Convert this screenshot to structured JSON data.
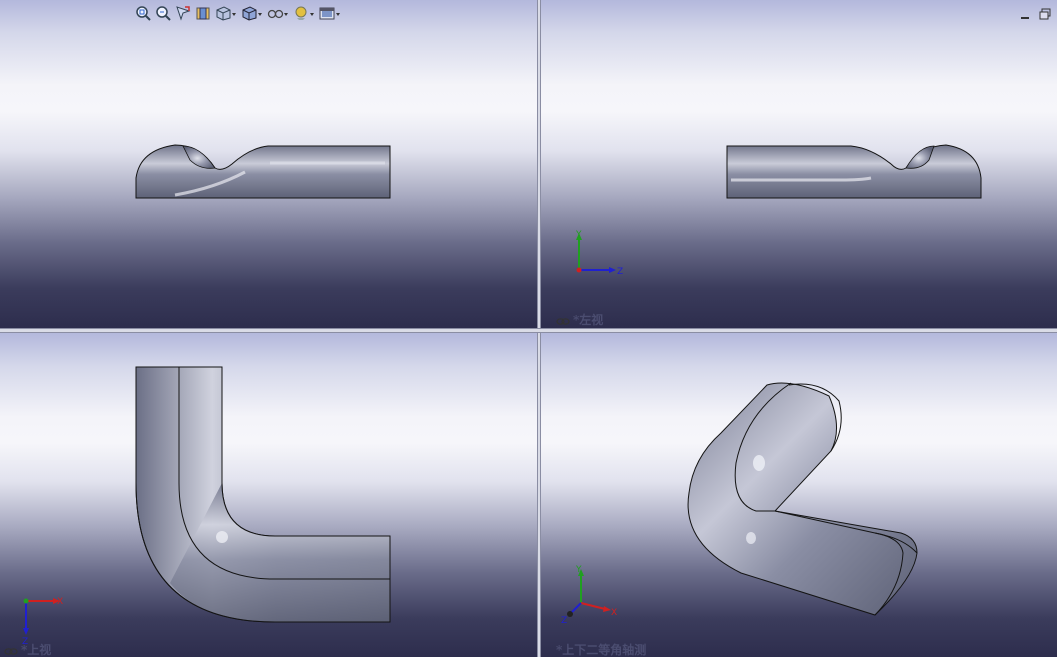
{
  "toolbar": {
    "items": [
      {
        "name": "zoom-to-fit-icon"
      },
      {
        "name": "zoom-to-area-icon"
      },
      {
        "name": "previous-view-icon"
      },
      {
        "name": "section-view-icon"
      },
      {
        "name": "view-orientation-icon"
      },
      {
        "name": "display-style-icon"
      },
      {
        "name": "hide-show-items-icon"
      },
      {
        "name": "edit-appearance-icon"
      },
      {
        "name": "apply-scene-icon"
      }
    ]
  },
  "views": {
    "top_left": {
      "label": ""
    },
    "top_right": {
      "label": "*左视"
    },
    "bottom_left": {
      "label": "*上视"
    },
    "bottom_right": {
      "label": "*上下二等角轴测"
    }
  },
  "triad": {
    "x": "X",
    "y": "Y",
    "z": "Z",
    "x_color": "#d02020",
    "y_color": "#20a020",
    "z_color": "#2020d0"
  },
  "colors": {
    "part_fill": "#8a8ea3",
    "edge": "#141414",
    "label": "#4b4d70"
  }
}
